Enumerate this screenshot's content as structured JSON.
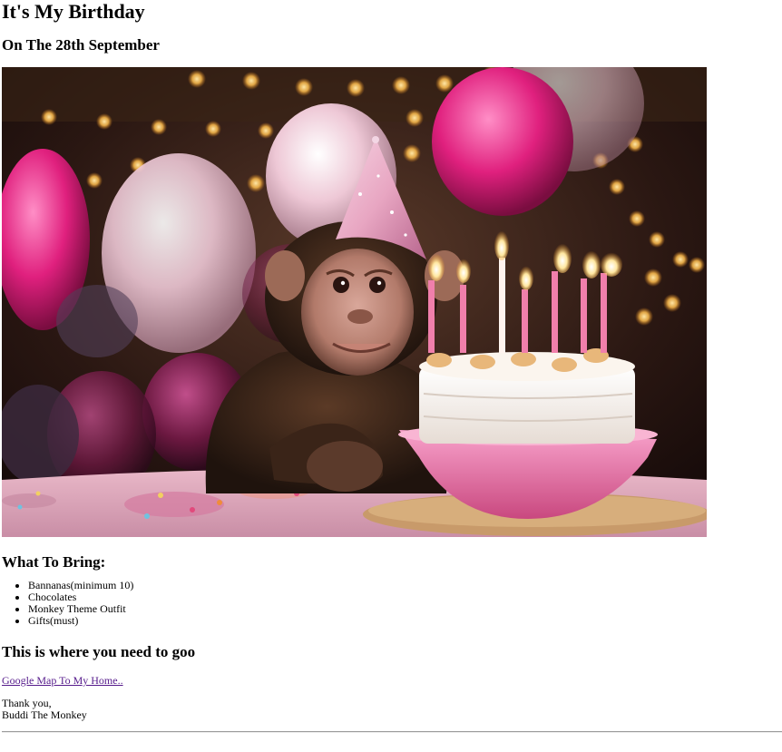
{
  "page": {
    "title": "It's My Birthday",
    "subtitle": "On The 28th September"
  },
  "hero_image": {
    "alt": "Chimpanzee in a pink party hat with a birthday cake"
  },
  "bring": {
    "heading": "What To Bring:",
    "items": [
      "Bannanas(minimum 10)",
      "Chocolates",
      "Monkey Theme Outfit",
      "Gifts(must)"
    ]
  },
  "location": {
    "heading": "This is where you need to goo",
    "link_text": "Google Map To My Home.."
  },
  "signoff": {
    "line1": "Thank you,",
    "line2": "Buddi The Monkey"
  },
  "colors": {
    "link_visited": "#551a8b",
    "balloon_pink": "#e8338a",
    "cake_pink": "#ec7fb0",
    "hr": "#9a9a9a"
  }
}
